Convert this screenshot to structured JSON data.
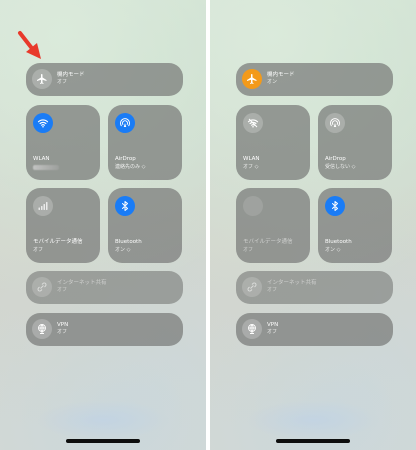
{
  "colors": {
    "active_blue": "#1a7cf6",
    "active_orange": "#f39a1a",
    "annotation_red": "#e8392b",
    "tile_gray": "#7a7c7a"
  },
  "panels": [
    {
      "airplane": {
        "label": "機内モード",
        "status": "オフ",
        "icon": "airplane-icon",
        "active": false
      },
      "wlan": {
        "label": "WLAN",
        "status": "",
        "network_redacted": true,
        "icon": "wifi-icon",
        "active": true
      },
      "airdrop": {
        "label": "AirDrop",
        "status": "連絡先のみ ◇",
        "icon": "airdrop-icon",
        "active": true
      },
      "cellular": {
        "label": "モバイルデータ通信",
        "status": "オフ",
        "icon": "antenna-icon",
        "active": false
      },
      "bluetooth": {
        "label": "Bluetooth",
        "status": "オン ◇",
        "icon": "bluetooth-icon",
        "active": true
      },
      "internet_sharing": {
        "label": "インターネット共有",
        "status": "オフ",
        "icon": "link-icon",
        "active": false
      },
      "vpn": {
        "label": "VPN",
        "status": "オフ",
        "icon": "globe-icon",
        "active": false
      }
    },
    {
      "airplane": {
        "label": "機内モード",
        "status": "オン",
        "icon": "airplane-icon",
        "active": true
      },
      "wlan": {
        "label": "WLAN",
        "status": "オフ ◇",
        "icon": "wifi-icon",
        "active": false
      },
      "airdrop": {
        "label": "AirDrop",
        "status": "受信しない ◇",
        "icon": "airdrop-icon",
        "active": false
      },
      "cellular": {
        "label": "モバイルデータ通信",
        "status": "オフ",
        "icon": "antenna-icon",
        "active": false
      },
      "bluetooth": {
        "label": "Bluetooth",
        "status": "オン ◇",
        "icon": "bluetooth-icon",
        "active": true
      },
      "internet_sharing": {
        "label": "インターネット共有",
        "status": "オフ",
        "icon": "link-icon",
        "active": false
      },
      "vpn": {
        "label": "VPN",
        "status": "オフ",
        "icon": "globe-icon",
        "active": false
      }
    }
  ]
}
